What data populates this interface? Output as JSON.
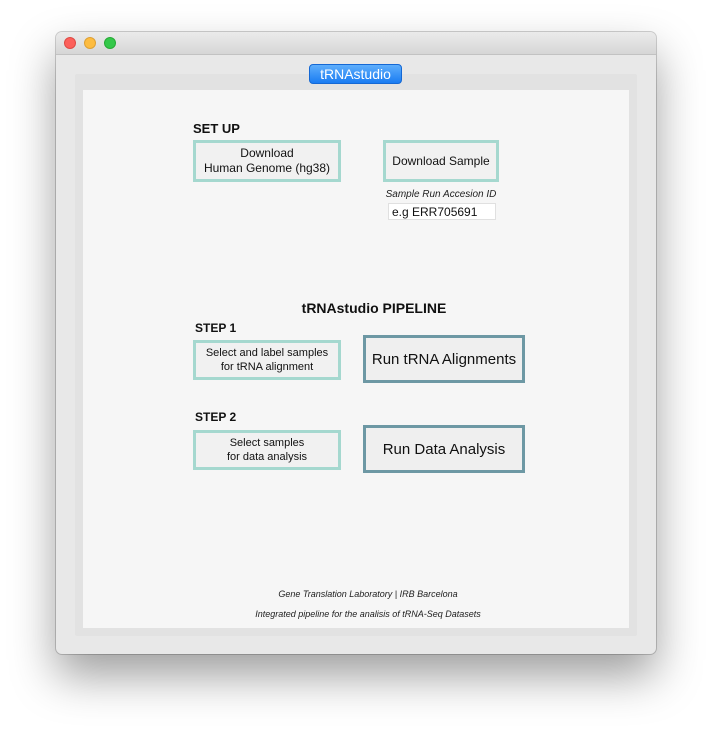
{
  "window": {
    "traffic_lights": [
      "close-icon",
      "minimize-icon",
      "zoom-icon"
    ],
    "tab_label": "tRNAstudio"
  },
  "setup": {
    "heading": "SET UP",
    "download_genome_label": "Download\nHuman Genome (hg38)",
    "download_sample_label": "Download Sample",
    "sample_id_caption": "Sample Run Accesion ID",
    "sample_id_placeholder": "e.g ERR705691"
  },
  "pipeline": {
    "heading": "tRNAstudio PIPELINE",
    "step1": {
      "label": "STEP 1",
      "select_label": "Select and label samples\nfor tRNA alignment",
      "run_label": "Run tRNA Alignments"
    },
    "step2": {
      "label": "STEP 2",
      "select_label": "Select samples\nfor data analysis",
      "run_label": "Run Data Analysis"
    }
  },
  "footer": {
    "lab": "Gene Translation Laboratory | IRB Barcelona",
    "description": "Integrated pipeline for the analisis of tRNA-Seq Datasets"
  },
  "colors": {
    "light_button_border": "#a5d8cf",
    "dark_button_border": "#6d98a4",
    "tab_blue": "#1a7cf2"
  }
}
